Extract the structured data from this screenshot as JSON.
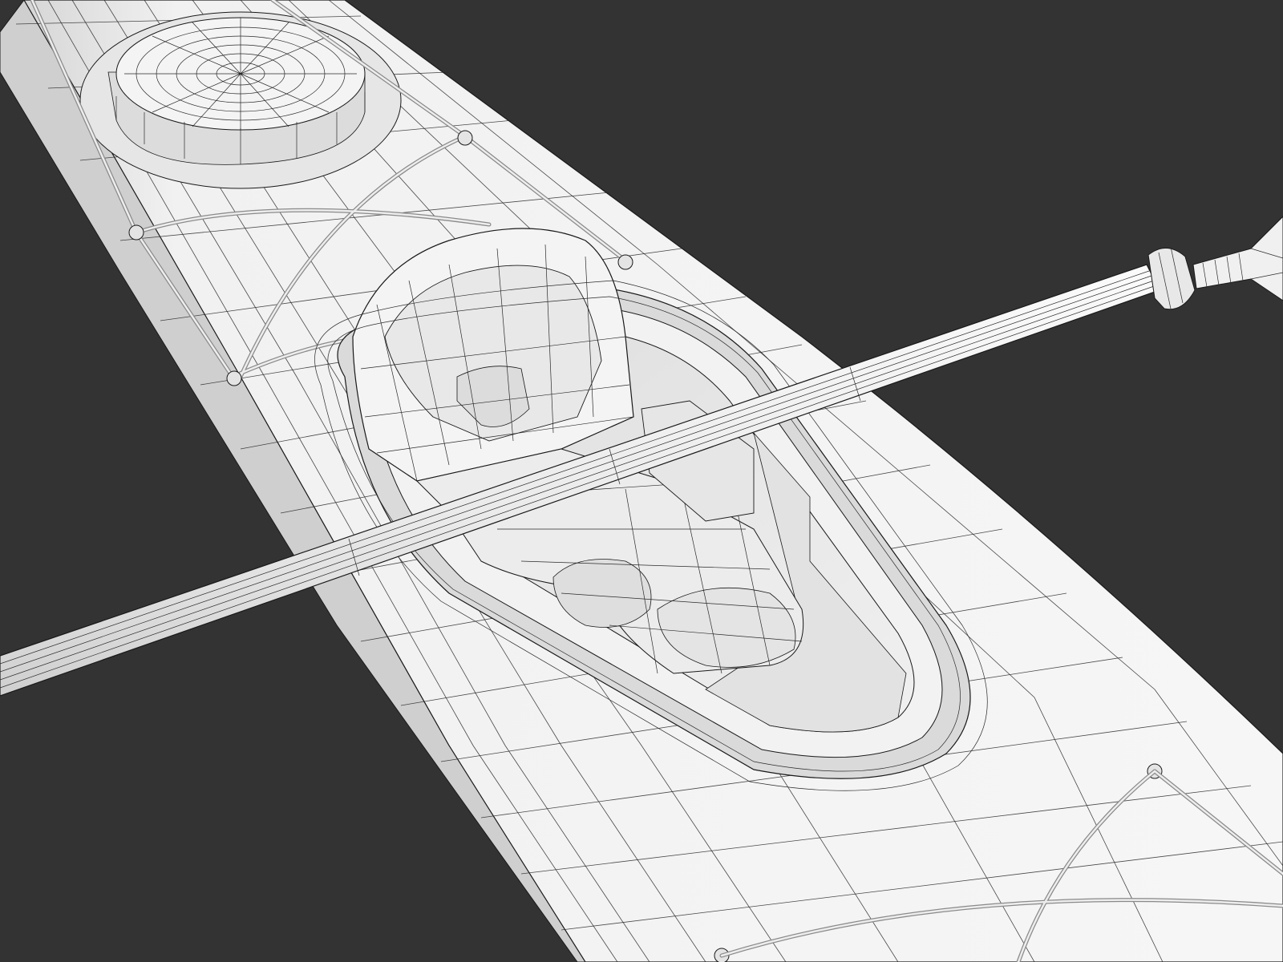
{
  "scene": {
    "subject": "kayak-with-paddle-wireframe",
    "render_style": "white clay render with black wireframe overlay",
    "colors": {
      "background": "#333333",
      "surface": "#f2f2f2",
      "surface_shadow": "#d9d9d9",
      "surface_dark": "#c4c4c4",
      "interior": "#e6e6e6",
      "wire": "#1a1a1a"
    }
  }
}
